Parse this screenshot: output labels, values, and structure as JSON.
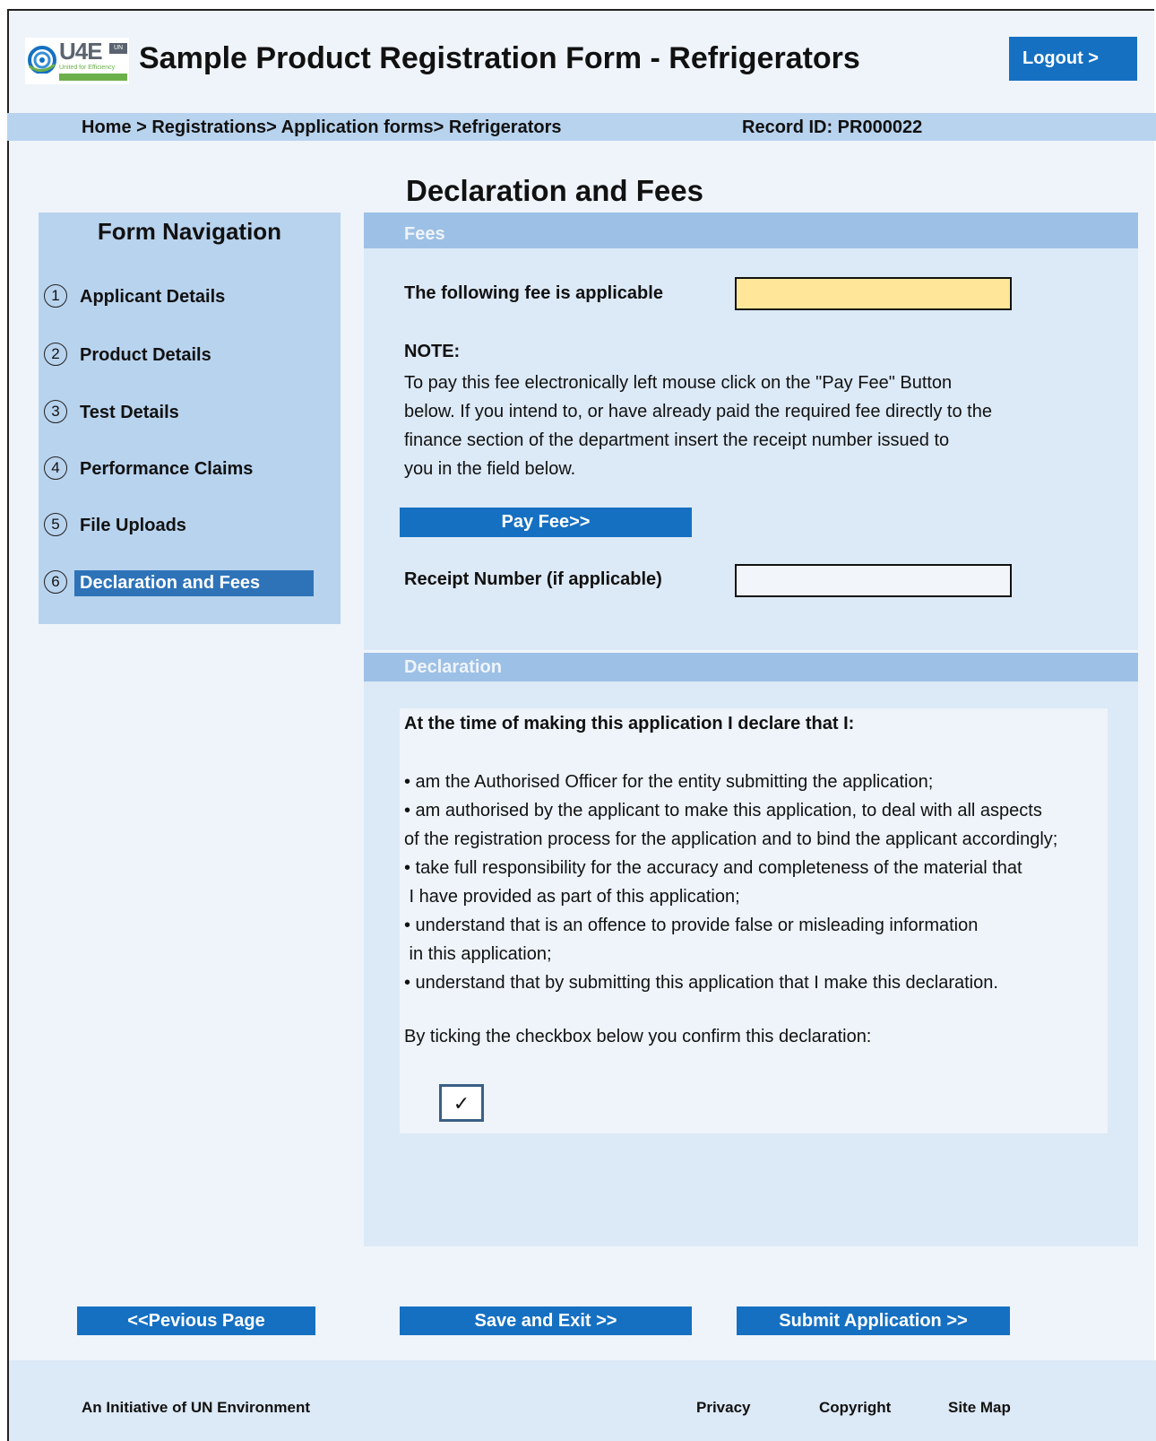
{
  "header": {
    "logo_text": "U4E",
    "logo_tag": "United for Efficiency",
    "logo_un": "UN",
    "title": "Sample Product Registration Form - Refrigerators",
    "logout_label": "Logout >"
  },
  "breadcrumb": {
    "path": "Home > Registrations> Application forms> Refrigerators",
    "record_id": "Record ID: PR000022"
  },
  "page_heading": "Declaration and Fees",
  "nav": {
    "title": "Form Navigation",
    "items": [
      {
        "num": "1",
        "label": "Applicant Details"
      },
      {
        "num": "2",
        "label": "Product Details"
      },
      {
        "num": "3",
        "label": "Test Details"
      },
      {
        "num": "4",
        "label": "Performance Claims"
      },
      {
        "num": "5",
        "label": "File Uploads"
      },
      {
        "num": "6",
        "label": "Declaration and Fees",
        "active": true
      }
    ]
  },
  "fees": {
    "heading": "Fees",
    "fee_label": "The following fee is applicable",
    "fee_value": "",
    "note_title": "NOTE:",
    "note_lines": [
      "To pay this fee electronically left mouse click on the \"Pay Fee\" Button",
      "below. If you intend to, or have already paid the required fee directly to the",
      "finance section of the department insert the receipt number issued to",
      "you in the field below."
    ],
    "pay_button": "Pay Fee>>",
    "receipt_label": "Receipt Number (if applicable)",
    "receipt_value": ""
  },
  "declaration": {
    "heading": "Declaration",
    "intro": "At the time of making this application I declare that I:",
    "lines": [
      "• am the Authorised Officer for the entity submitting the application;",
      "• am authorised by the applicant to make this application, to deal with all aspects",
      "of the registration process for the application and to bind the applicant accordingly;",
      "• take full responsibility for the accuracy and completeness of the material that",
      " I have provided as part of this application;",
      "• understand that is an offence to provide false or misleading information",
      " in this application;",
      "• understand that by submitting this application that I make this declaration."
    ],
    "confirm_text": "By ticking the checkbox below you confirm this declaration:",
    "checkbox_mark": "✓"
  },
  "actions": {
    "previous": "<<Pevious Page",
    "save": "Save and Exit >>",
    "submit": "Submit Application >>"
  },
  "footer": {
    "initiative": "An Initiative of UN Environment",
    "privacy": "Privacy",
    "copyright": "Copyright",
    "sitemap": "Site Map"
  },
  "colors": {
    "accent": "#1570c2",
    "nav_active": "#2e73b8",
    "section_header": "#9dc0e6",
    "panel": "#dce9f6",
    "fee_field": "#ffe699"
  }
}
